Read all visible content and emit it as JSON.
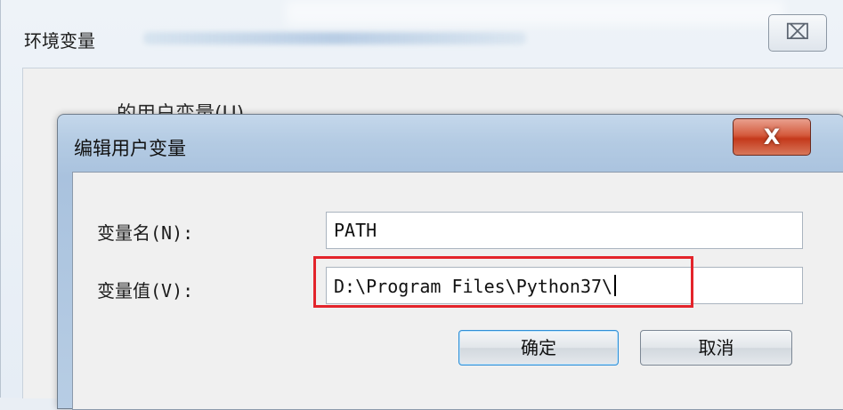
{
  "outer_window": {
    "title": "环境变量",
    "close_glyph": "⌧",
    "peek_text": "的用户变量(U)"
  },
  "dialog": {
    "title": "编辑用户变量",
    "close_glyph": "X",
    "variable_name_label": "变量名(N):",
    "variable_name_value": "PATH",
    "variable_value_label": "变量值(V):",
    "variable_value_value": "D:\\Program Files\\Python37\\",
    "ok_label": "确定",
    "cancel_label": "取消"
  },
  "annotation": {
    "highlight_color": "#e3242b"
  },
  "colors": {
    "close_button": "#c4391b",
    "default_button_border": "#2f8fd6"
  }
}
